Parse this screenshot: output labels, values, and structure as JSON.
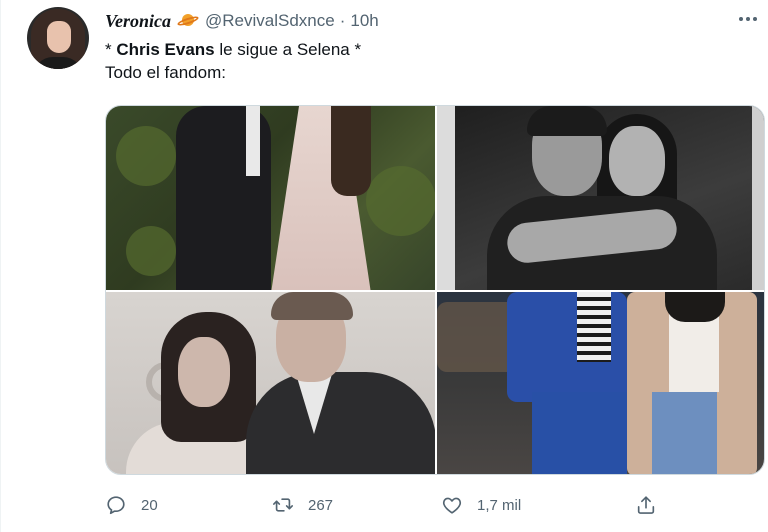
{
  "tweet": {
    "display_name": "Veronica",
    "handle": "@RevivalSdxnce",
    "separator": "·",
    "time": "10h",
    "text_line1_prefix": "* ",
    "text_line1_bold": "Chris Evans",
    "text_line1_rest": " le sigue a Selena *",
    "text_line2": "Todo el fandom:"
  },
  "icons": {
    "avatar": "avatar-image",
    "name_emoji": "ringed-planet-icon",
    "more": "more-horizontal-icon",
    "reply": "reply-icon",
    "retweet": "retweet-icon",
    "like": "heart-icon",
    "share": "share-icon"
  },
  "media": [
    {
      "description": "photo-1"
    },
    {
      "description": "photo-2"
    },
    {
      "description": "photo-3"
    },
    {
      "description": "photo-4"
    }
  ],
  "actions": {
    "replies": "20",
    "retweets": "267",
    "likes": "1,7 mil"
  },
  "colors": {
    "text": "#0f1419",
    "secondary": "#536471",
    "border": "#cfd9de"
  }
}
